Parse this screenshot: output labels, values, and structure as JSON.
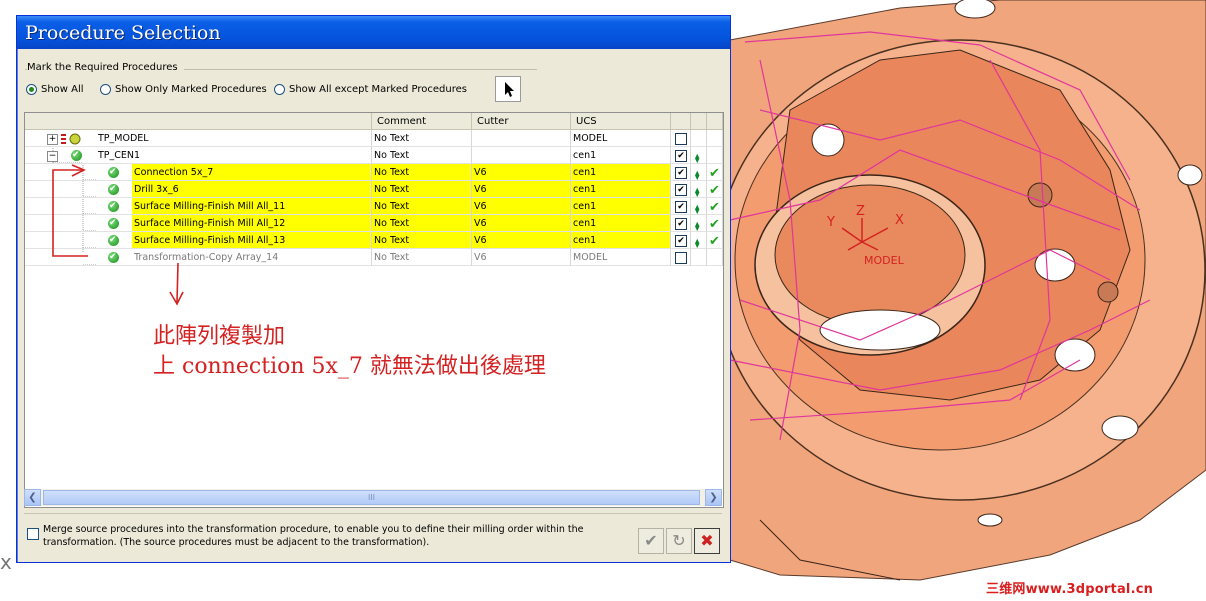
{
  "dialog": {
    "title": "Procedure Selection",
    "mark_group_label": "Mark the Required Procedures",
    "radios": [
      {
        "label": "Show All",
        "selected": true
      },
      {
        "label": "Show Only Marked Procedures",
        "selected": false
      },
      {
        "label": "Show All except Marked Procedures",
        "selected": false
      }
    ],
    "columns": {
      "comment": "Comment",
      "cutter": "Cutter",
      "ucs": "UCS"
    },
    "rows": [
      {
        "name": "TP_MODEL",
        "comment": "No Text",
        "cutter": "",
        "ucs": "MODEL",
        "checked": false,
        "highlight": false,
        "grey": false
      },
      {
        "name": "TP_CEN1",
        "comment": "No Text",
        "cutter": "",
        "ucs": "cen1",
        "checked": true,
        "highlight": false,
        "grey": false
      },
      {
        "name": "Connection 5x_7",
        "comment": "No Text",
        "cutter": "V6",
        "ucs": "cen1",
        "checked": true,
        "highlight": true,
        "grey": false
      },
      {
        "name": "Drill 3x_6",
        "comment": "No Text",
        "cutter": "V6",
        "ucs": "cen1",
        "checked": true,
        "highlight": true,
        "grey": false
      },
      {
        "name": "Surface Milling-Finish Mill All_11",
        "comment": "No Text",
        "cutter": "V6",
        "ucs": "cen1",
        "checked": true,
        "highlight": true,
        "grey": false
      },
      {
        "name": "Surface Milling-Finish Mill All_12",
        "comment": "No Text",
        "cutter": "V6",
        "ucs": "cen1",
        "checked": true,
        "highlight": true,
        "grey": false
      },
      {
        "name": "Surface Milling-Finish Mill All_13",
        "comment": "No Text",
        "cutter": "V6",
        "ucs": "cen1",
        "checked": true,
        "highlight": true,
        "grey": false
      },
      {
        "name": "Transformation-Copy Array_14",
        "comment": "No Text",
        "cutter": "V6",
        "ucs": "MODEL",
        "checked": false,
        "highlight": false,
        "grey": true
      }
    ],
    "scroll_grip": "III",
    "merge_text_1": "Merge source procedures into the transformation procedure, to enable you to define their milling order within the",
    "merge_text_2": "transformation. (The source procedures must be adjacent to the transformation)."
  },
  "annotation": {
    "line1": "此陣列複製加",
    "line2": "上 connection 5x_7 就無法做出後處理"
  },
  "model_view": {
    "axis_x": "X",
    "axis_y": "Y",
    "axis_z": "Z",
    "ucs_label": "MODEL"
  },
  "stray_char": "x",
  "watermark": "三维网www.3dportal.cn",
  "colors": {
    "highlight": "#ffff00",
    "annotation": "#d42222",
    "part": "#f2a47a",
    "toolpath": "#e0359b"
  }
}
